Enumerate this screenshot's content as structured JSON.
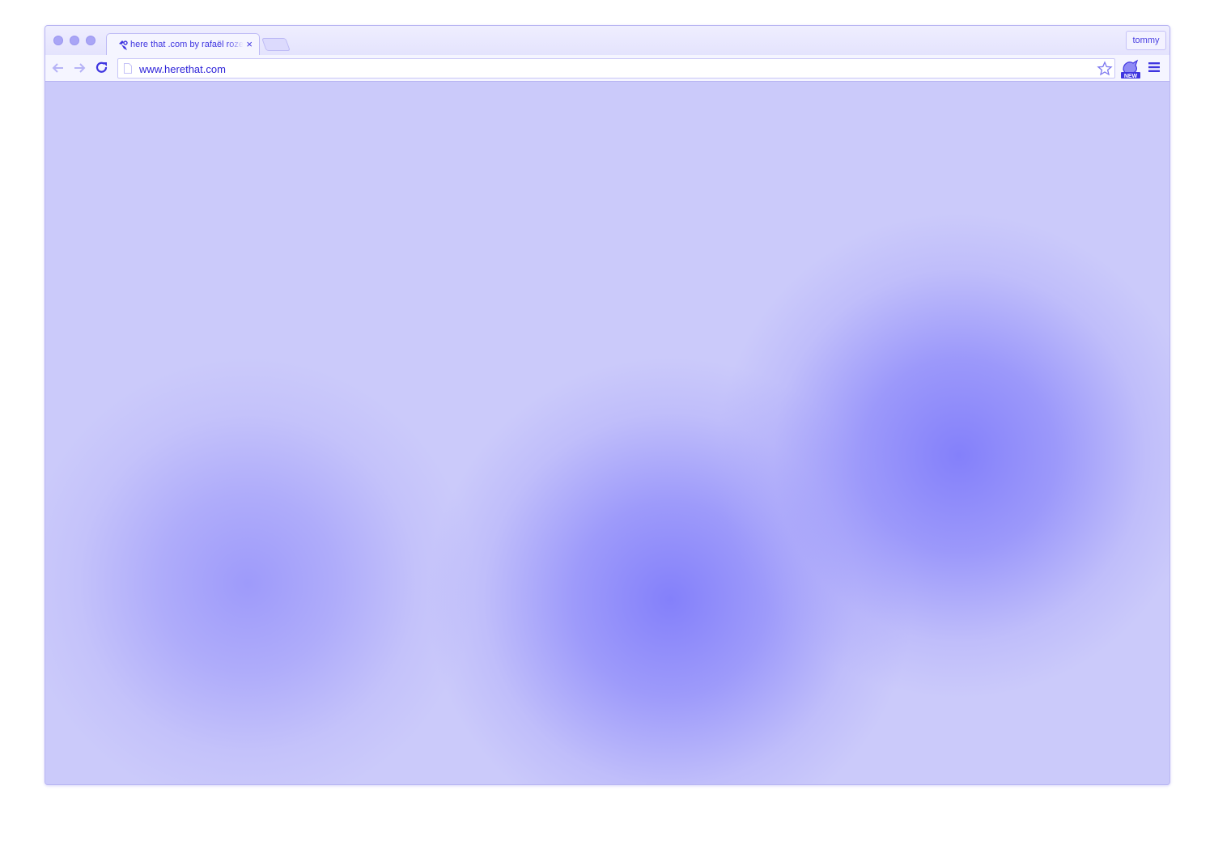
{
  "window": {
    "tab": {
      "title": "here that .com by rafaël rozendaal",
      "close_label": "×"
    },
    "profile_name": "tommy"
  },
  "toolbar": {
    "url": "www.herethat.com",
    "extension_badge": "NEW"
  },
  "colors": {
    "accent": "#3f35e0",
    "page_background": "#cbcafa",
    "blob": "#8a86fa"
  },
  "icons": {
    "back": "back-arrow-icon",
    "forward": "forward-arrow-icon",
    "reload": "reload-icon",
    "page": "page-icon",
    "bookmark": "star-icon",
    "extension": "extension-icon",
    "menu": "hamburger-menu-icon",
    "favicon": "favicon-icon"
  }
}
